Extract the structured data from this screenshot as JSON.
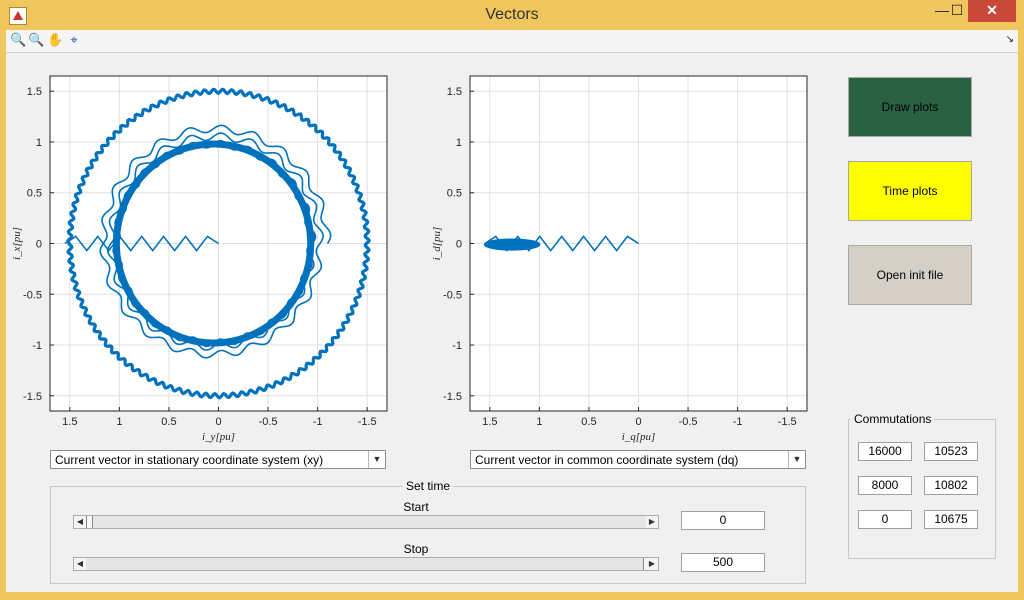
{
  "window": {
    "title": "Vectors",
    "min": "—",
    "max": "☐",
    "close": "✕"
  },
  "toolbar": {
    "icons": [
      "zoom-in-icon",
      "zoom-out-icon",
      "pan-icon",
      "data-cursor-icon"
    ],
    "glyphs": [
      "🔍",
      "🔍",
      "✋",
      "⌖"
    ],
    "corner": "↘"
  },
  "plot1": {
    "xlabel": "i_y[pu]",
    "ylabel": "i_x[pu]",
    "xticks": [
      "1.5",
      "1",
      "0.5",
      "0",
      "-0.5",
      "-1",
      "-1.5"
    ],
    "yticks": [
      "1.5",
      "1",
      "0.5",
      "0",
      "-0.5",
      "-1",
      "-1.5"
    ],
    "select": "Current vector in stationary coordinate system (xy)"
  },
  "plot2": {
    "xlabel": "i_q[pu]",
    "ylabel": "i_d[pu]",
    "xticks": [
      "1.5",
      "1",
      "0.5",
      "0",
      "-0.5",
      "-1",
      "-1.5"
    ],
    "yticks": [
      "1.5",
      "1",
      "0.5",
      "0",
      "-0.5",
      "-1",
      "-1.5"
    ],
    "select": "Current vector in common coordinate system (dq)"
  },
  "chart_data": [
    {
      "type": "line",
      "xlabel": "i_y [pu]",
      "ylabel": "i_x [pu]",
      "xlim": [
        1.7,
        -1.7
      ],
      "ylim": [
        -1.65,
        1.65
      ],
      "grid": true,
      "series": [
        {
          "shape": "circle",
          "center": [
            0,
            0
          ],
          "radius": 1.5
        },
        {
          "shape": "spiral",
          "center": [
            0.05,
            0
          ],
          "radius_start": 1.15,
          "radius_end": 0.98
        },
        {
          "shape": "zigzag",
          "from": [
            1.55,
            0
          ],
          "to": [
            0,
            0
          ],
          "amplitude": 0.07
        }
      ],
      "color": "#0072bd"
    },
    {
      "type": "line",
      "xlabel": "i_q [pu]",
      "ylabel": "i_d [pu]",
      "xlim": [
        1.7,
        -1.7
      ],
      "ylim": [
        -1.65,
        1.65
      ],
      "grid": true,
      "series": [
        {
          "shape": "zigzag",
          "from": [
            1.55,
            0
          ],
          "to": [
            0,
            0
          ],
          "amplitude": 0.07
        },
        {
          "shape": "blob",
          "x_range": [
            1.0,
            1.55
          ],
          "y_range": [
            -0.05,
            0.05
          ]
        }
      ],
      "color": "#0072bd"
    }
  ],
  "set_time": {
    "title": "Set time",
    "start_label": "Start",
    "stop_label": "Stop",
    "start_value": "0",
    "stop_value": "500",
    "start_position": 0.0,
    "stop_position": 1.0
  },
  "buttons": {
    "draw": {
      "label": "Draw plots",
      "color": "#2a6142"
    },
    "time": {
      "label": "Time plots",
      "color": "#ffff00"
    },
    "open": {
      "label": "Open init file",
      "color": "#d4d0c8"
    }
  },
  "commutations": {
    "title": "Commutations",
    "values": [
      "16000",
      "10523",
      "8000",
      "10802",
      "0",
      "10675"
    ]
  }
}
